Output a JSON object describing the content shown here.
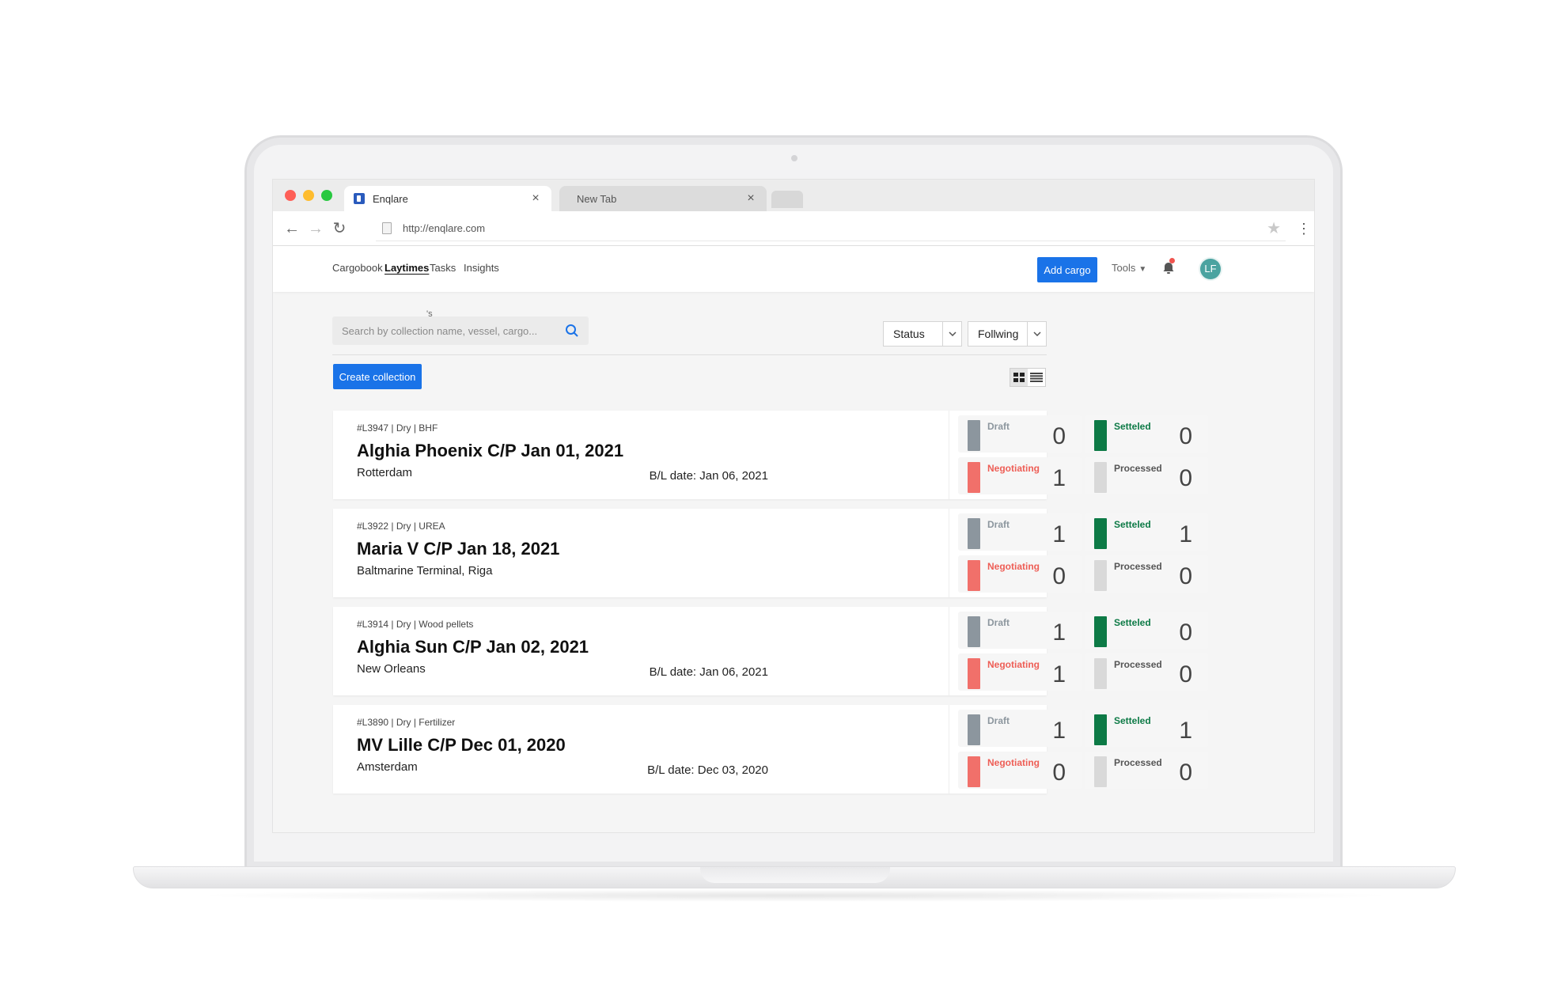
{
  "browser": {
    "tabs": [
      {
        "title": "Enqlare"
      },
      {
        "title": "New Tab"
      }
    ],
    "url": "http://enqlare.com"
  },
  "nav": {
    "links": [
      "Cargobook",
      "Laytimes",
      "Tasks",
      "Insights"
    ],
    "active": "Laytimes",
    "add_cargo": "Add cargo",
    "tools": "Tools",
    "avatar_initials": "LF"
  },
  "search": {
    "placeholder": "Search by collection name, vessel, cargo...",
    "stray_mark": "'s"
  },
  "filters": {
    "status": "Status",
    "following": "Follwing"
  },
  "create_collection": "Create collection",
  "stat_labels": {
    "draft": "Draft",
    "negotiating": "Negotiating",
    "settled": "Setteled",
    "processed": "Processed"
  },
  "collections": [
    {
      "meta": "#L3947 | Dry | BHF",
      "title": "Alghia Phoenix C/P Jan 01, 2021",
      "location": "Rotterdam",
      "bl_date": "B/L date: Jan 06, 2021",
      "draft": "0",
      "negotiating": "1",
      "settled": "0",
      "processed": "0"
    },
    {
      "meta": "#L3922 | Dry | UREA",
      "title": "Maria V C/P Jan 18, 2021",
      "location": "Baltmarine Terminal, Riga",
      "bl_date": "",
      "draft": "1",
      "negotiating": "0",
      "settled": "1",
      "processed": "0"
    },
    {
      "meta": "#L3914 | Dry | Wood pellets",
      "title": "Alghia Sun C/P Jan 02, 2021",
      "location": "New Orleans",
      "bl_date": "B/L date: Jan 06, 2021",
      "draft": "1",
      "negotiating": "1",
      "settled": "0",
      "processed": "0"
    },
    {
      "meta": "#L3890 | Dry | Fertilizer",
      "title": "MV Lille C/P Dec 01, 2020",
      "location": "Amsterdam",
      "bl_date": "B/L date: Dec 03, 2020",
      "draft": "1",
      "negotiating": "0",
      "settled": "1",
      "processed": "0"
    }
  ],
  "colors": {
    "accent": "#1a73e8",
    "draft": "#8c969e",
    "negotiating": "#f1706a",
    "settled": "#0d7a46",
    "processed": "#d9d9d9"
  }
}
